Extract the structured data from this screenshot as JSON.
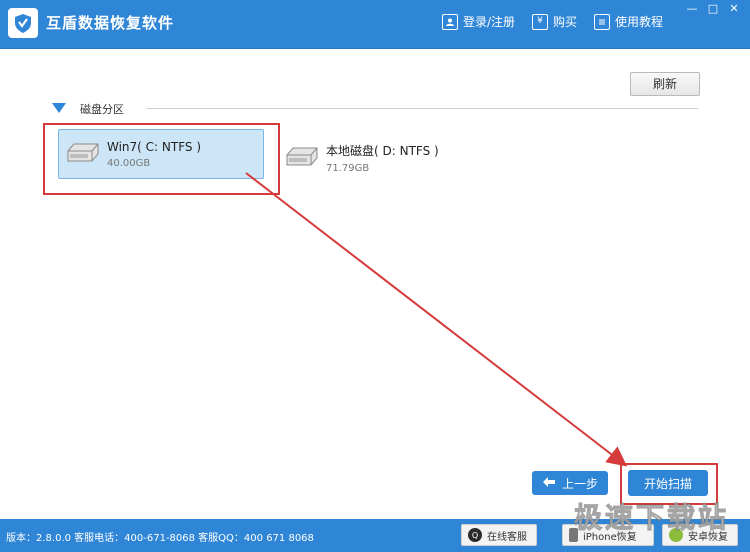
{
  "app": {
    "title": "互盾数据恢复软件",
    "links": [
      {
        "label": "登录/注册",
        "icon": "user-icon"
      },
      {
        "label": "购买",
        "icon": "yen-icon"
      },
      {
        "label": "使用教程",
        "icon": "book-icon"
      }
    ],
    "window_controls": {
      "minimize": "—",
      "maximize": "□",
      "close": "✕"
    }
  },
  "toolbar": {
    "refresh_label": "刷新"
  },
  "section": {
    "label": "磁盘分区"
  },
  "disks": [
    {
      "name": "Win7( C: NTFS )",
      "size": "40.00GB",
      "selected": true
    },
    {
      "name": "本地磁盘( D: NTFS )",
      "size": "71.79GB",
      "selected": false
    }
  ],
  "actions": {
    "prev_label": "上一步",
    "scan_label": "开始扫描"
  },
  "statusbar": {
    "info": "版本：2.8.0.0  客服电话：400-671-8068   客服QQ：400 671 8068",
    "buttons": [
      {
        "label": "在线客服",
        "icon": "qq-icon"
      },
      {
        "label": "iPhone恢复",
        "icon": "phone-icon"
      },
      {
        "label": "安卓恢复",
        "icon": "android-icon"
      }
    ]
  },
  "watermark": "极速下载站",
  "colors": {
    "accent": "#2f86d6",
    "highlight": "#d63b3b",
    "selected_bg": "#cde6f7"
  }
}
